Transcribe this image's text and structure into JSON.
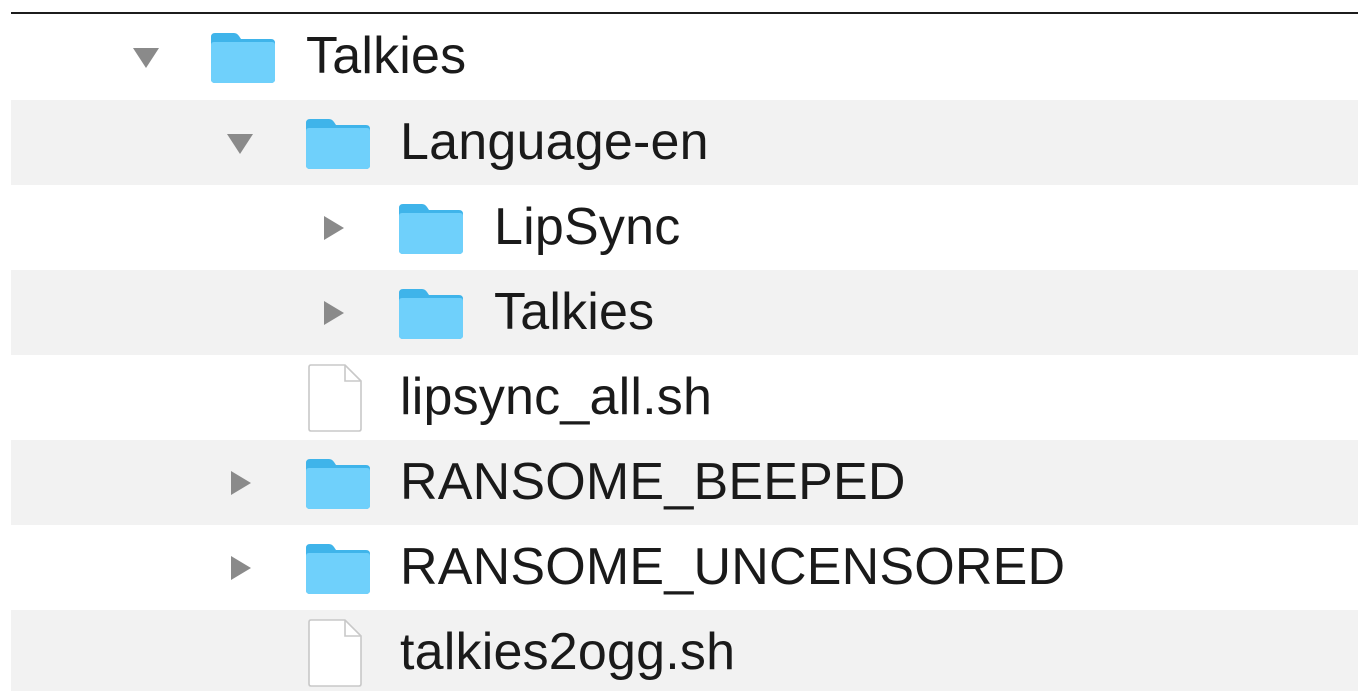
{
  "tree": {
    "rows": [
      {
        "name": "Talkies",
        "type": "folder",
        "state": "expanded",
        "depth": 0
      },
      {
        "name": "Language-en",
        "type": "folder",
        "state": "expanded",
        "depth": 1
      },
      {
        "name": "LipSync",
        "type": "folder",
        "state": "collapsed",
        "depth": 2
      },
      {
        "name": "Talkies",
        "type": "folder",
        "state": "collapsed",
        "depth": 2
      },
      {
        "name": "lipsync_all.sh",
        "type": "file",
        "state": "none",
        "depth": 1
      },
      {
        "name": "RANSOME_BEEPED",
        "type": "folder",
        "state": "collapsed",
        "depth": 1
      },
      {
        "name": "RANSOME_UNCENSORED",
        "type": "folder",
        "state": "collapsed",
        "depth": 1
      },
      {
        "name": "talkies2ogg.sh",
        "type": "file",
        "state": "none",
        "depth": 1
      }
    ]
  },
  "colors": {
    "row_alt": "#f2f2f2",
    "folder_blue": "#5ac8fa",
    "disclosure_gray": "#8a8a8a",
    "text": "#1a1a1a"
  }
}
